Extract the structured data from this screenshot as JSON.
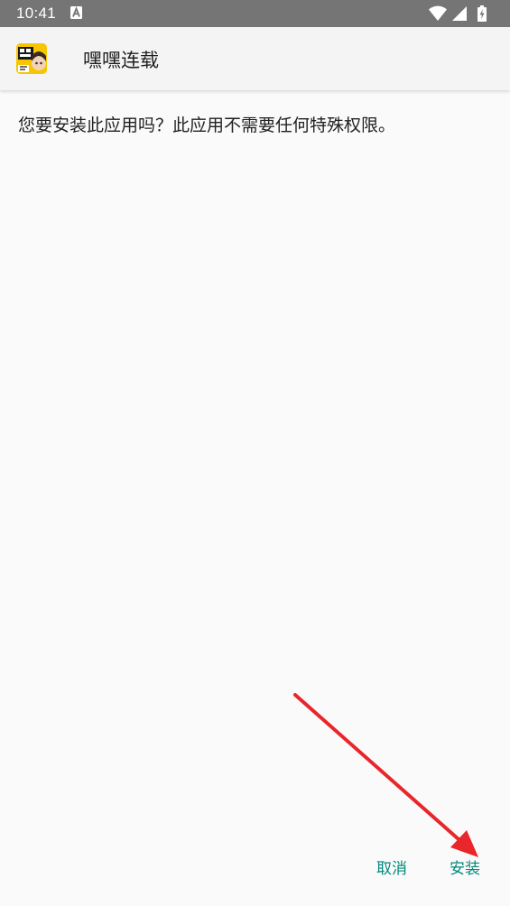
{
  "status_bar": {
    "time": "10:41",
    "notification_icon": "a-letter-icon",
    "icons": [
      "wifi-icon",
      "signal-icon",
      "battery-charging-icon"
    ]
  },
  "app_bar": {
    "app_icon": "app-icon-heihei",
    "app_name": "嘿嘿连载"
  },
  "body": {
    "message": "您要安装此应用吗？此应用不需要任何特殊权限。"
  },
  "buttons": {
    "cancel": "取消",
    "install": "安装"
  },
  "annotation": {
    "type": "red-arrow",
    "color": "#e8262b"
  },
  "colors": {
    "status_bar": "#757575",
    "app_bar": "#f4f4f4",
    "background": "#fafafa",
    "button_text": "#00897b"
  }
}
